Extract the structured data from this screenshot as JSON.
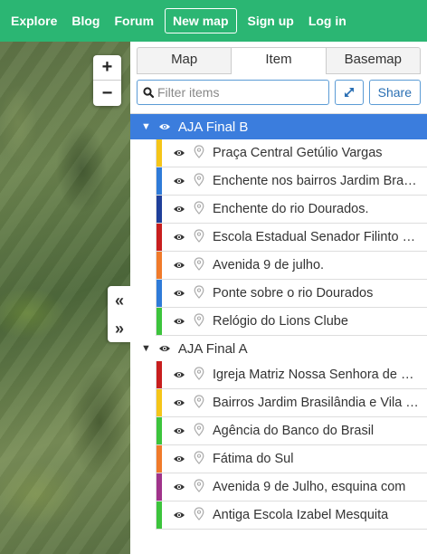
{
  "nav": {
    "links": [
      "Explore",
      "Blog",
      "Forum",
      "New map",
      "Sign up",
      "Log in"
    ]
  },
  "map": {
    "zoom_in": "+",
    "zoom_out": "−",
    "collapse": "«",
    "expand": "»"
  },
  "panel": {
    "tabs": [
      "Map",
      "Item",
      "Basemap"
    ],
    "active_tab": "Item",
    "filter_placeholder": "Filter items",
    "share_label": "Share"
  },
  "groups": [
    {
      "name": "AJA Final B",
      "selected": true,
      "items": [
        {
          "label": "Praça Central Getúlio Vargas",
          "color": "#f5c518"
        },
        {
          "label": "Enchente nos bairros Jardim Brasilândia",
          "color": "#2f7bd8"
        },
        {
          "label": "Enchente do rio Dourados.",
          "color": "#1f3f9a"
        },
        {
          "label": "Escola Estadual Senador Filinto Müller",
          "color": "#c81e1e"
        },
        {
          "label": "Avenida 9 de julho.",
          "color": "#f07a2a"
        },
        {
          "label": "Ponte sobre o rio Dourados",
          "color": "#2f7bd8"
        },
        {
          "label": "Relógio do Lions Clube",
          "color": "#3cc43c"
        }
      ]
    },
    {
      "name": "AJA Final A",
      "selected": false,
      "items": [
        {
          "label": "Igreja Matriz Nossa Senhora de Fátima",
          "color": "#c81e1e"
        },
        {
          "label": "Bairros Jardim Brasilândia e Vila Nova",
          "color": "#f5c518"
        },
        {
          "label": "Agência do Banco do Brasil",
          "color": "#3cc43c"
        },
        {
          "label": "Fátima do Sul",
          "color": "#f07a2a"
        },
        {
          "label": "Avenida 9 de Julho, esquina com",
          "color": "#a0338a"
        },
        {
          "label": "Antiga Escola Izabel Mesquita",
          "color": "#3cc43c"
        }
      ]
    }
  ]
}
